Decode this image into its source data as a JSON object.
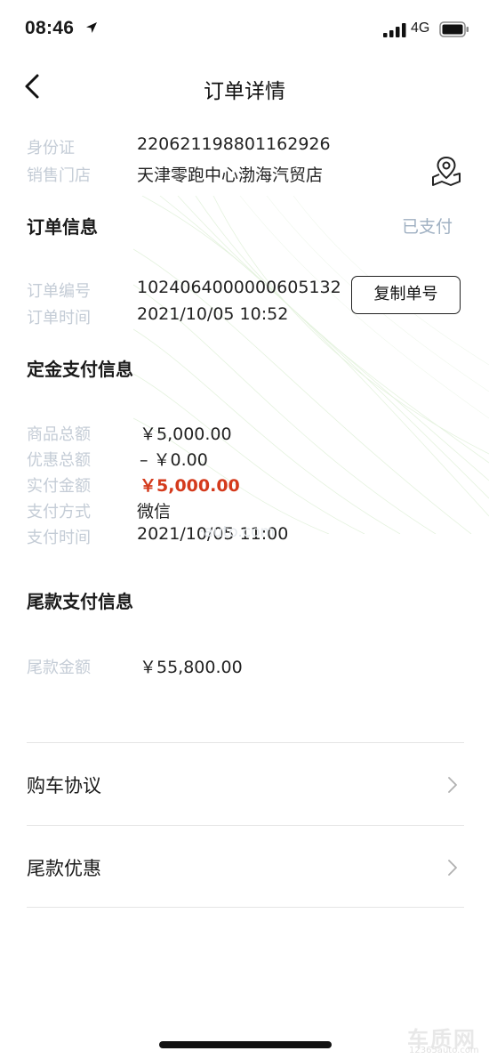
{
  "status_bar": {
    "time": "08:46",
    "network": "4G"
  },
  "nav": {
    "title": "订单详情"
  },
  "customer": {
    "id_label": "身份证",
    "id_value": "220621198801162926",
    "store_label": "销售门店",
    "store_value": "天津零跑中心渤海汽贸店"
  },
  "order_info": {
    "title": "订单信息",
    "status": "已支付",
    "number_label": "订单编号",
    "number_value": "1024064000000605132",
    "copy_button": "复制单号",
    "time_label": "订单时间",
    "time_value": "2021/10/05 10:52"
  },
  "deposit": {
    "title": "定金支付信息",
    "total_label": "商品总额",
    "total_value": "￥5,000.00",
    "discount_label": "优惠总额",
    "discount_value": "– ￥0.00",
    "paid_label": "实付金额",
    "paid_value": "￥5,000.00",
    "method_label": "支付方式",
    "method_value": "微信",
    "pay_time_label": "支付时间",
    "pay_time_value": "2021/10/05 11:00"
  },
  "final": {
    "title": "尾款支付信息",
    "amount_label": "尾款金额",
    "amount_value": "￥55,800.00"
  },
  "links": [
    {
      "label": "购车协议"
    },
    {
      "label": "尾款优惠"
    }
  ],
  "watermark": {
    "text": "·auto.com",
    "logo": "车质网",
    "logo_sub": "12365auto.com"
  },
  "colors": {
    "accent_red": "#d43a1c",
    "label_gray": "#c4ccd6",
    "status_blue_gray": "#9fb0c2"
  }
}
